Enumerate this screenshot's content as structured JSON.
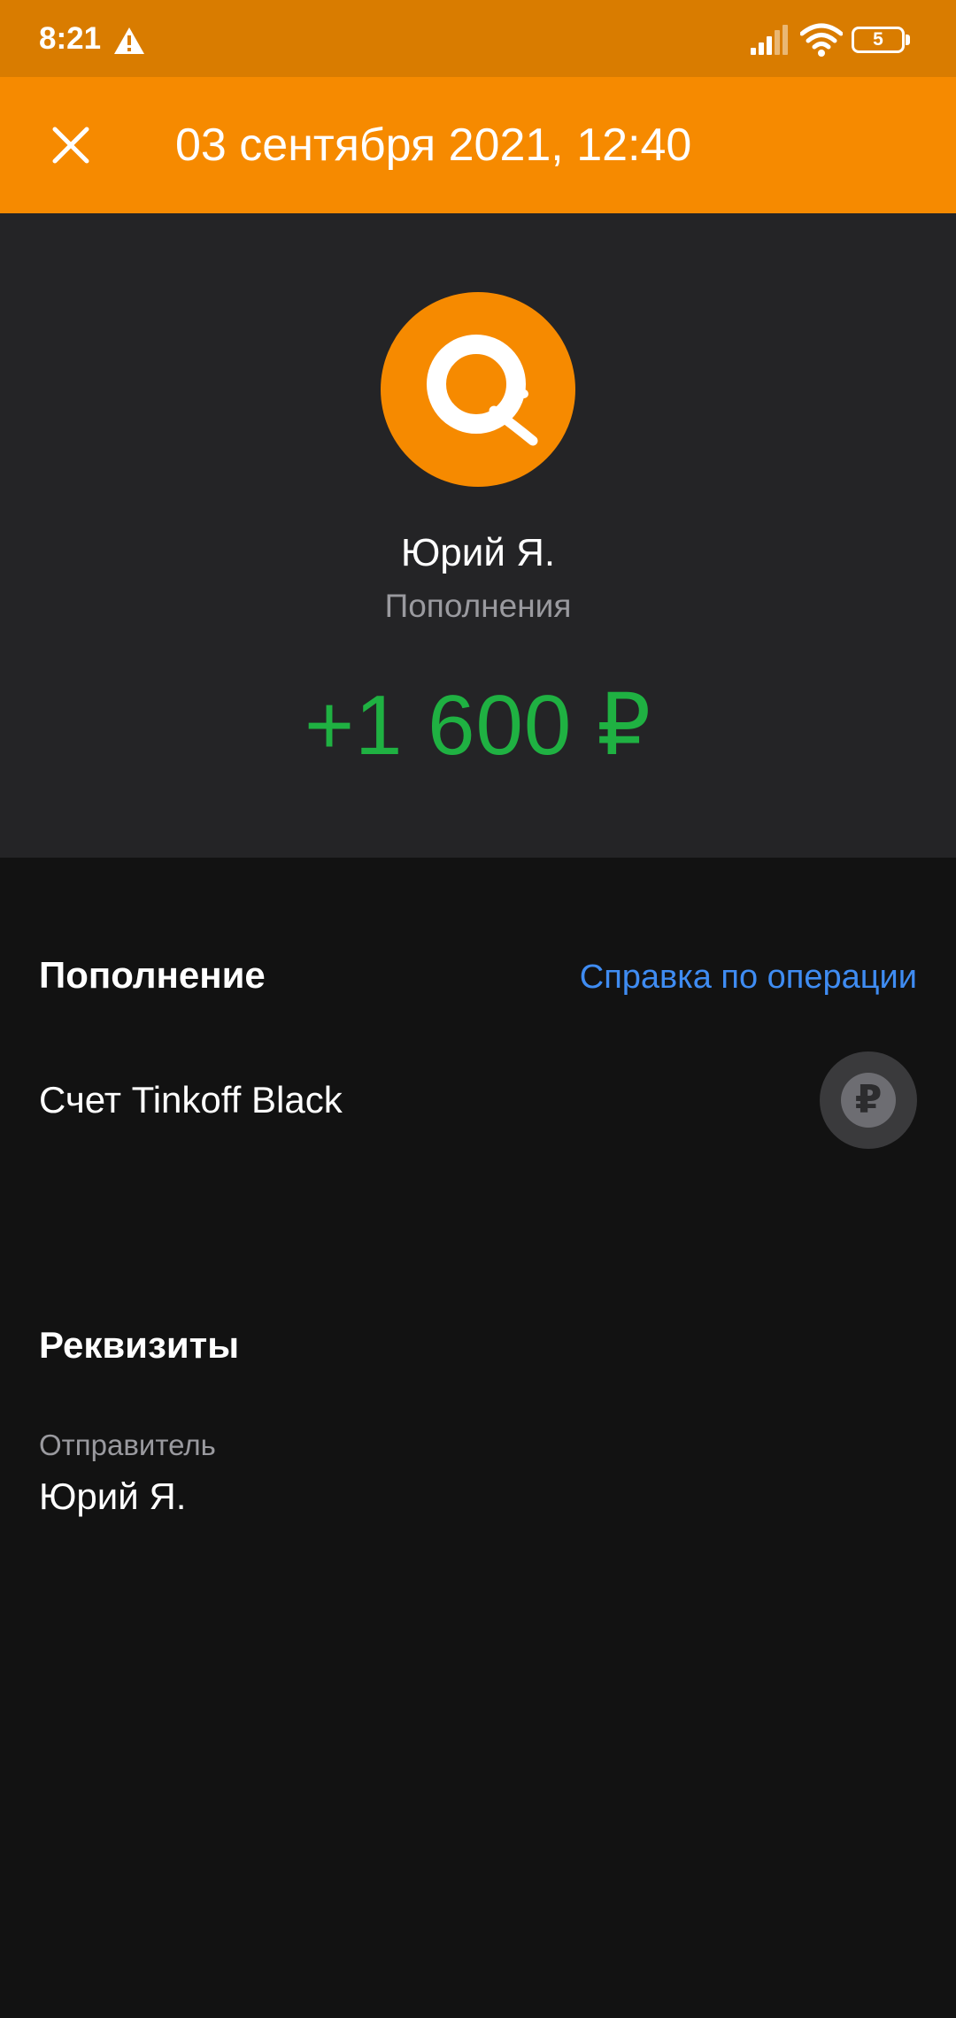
{
  "status_bar": {
    "time": "8:21",
    "battery_level": "5",
    "icons": [
      "warning-icon",
      "signal-icon",
      "wifi-icon",
      "battery-icon"
    ]
  },
  "header": {
    "title": "03 сентября 2021, 12:40",
    "close_icon": "close-icon"
  },
  "hero": {
    "logo_icon": "qiwi-logo-icon",
    "name": "Юрий Я.",
    "category": "Пополнения",
    "amount": "+1 600 ₽"
  },
  "operation": {
    "title": "Пополнение",
    "help_link": "Справка по операции",
    "account_label": "Счет Tinkoff Black",
    "account_icon_symbol": "₽",
    "account_icon": "ruble-coin-icon"
  },
  "details": {
    "title": "Реквизиты",
    "sender_label": "Отправитель",
    "sender_value": "Юрий Я."
  },
  "colors": {
    "status_bar": "#d97c00",
    "app_bar": "#f68a00",
    "hero_bg": "#242426",
    "page_bg": "#121212",
    "amount_positive": "#1fb142",
    "link": "#3f8cf2",
    "secondary_text": "#9a9a9f"
  }
}
